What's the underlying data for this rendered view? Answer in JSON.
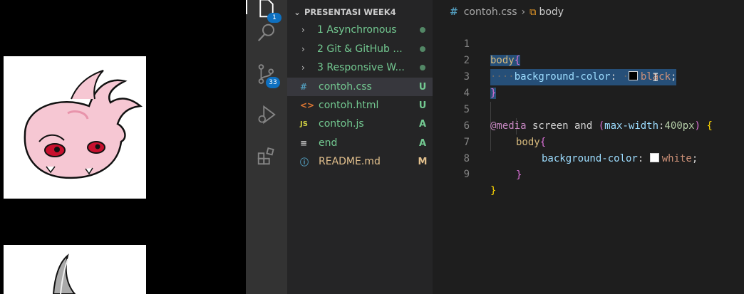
{
  "explorer": {
    "section_title": "PRESENTASI WEEK4",
    "items": [
      {
        "name": "1 Asynchronous",
        "type": "folder",
        "status": "dot",
        "color": "#73c991"
      },
      {
        "name": "2 Git & GitHub ...",
        "type": "folder",
        "status": "dot",
        "color": "#73c991"
      },
      {
        "name": "3 Responsive W...",
        "type": "folder",
        "status": "dot",
        "color": "#73c991"
      },
      {
        "name": "contoh.css",
        "type": "css",
        "icon": "#",
        "status": "U",
        "color": "#73c991"
      },
      {
        "name": "contoh.html",
        "type": "html",
        "icon": "<>",
        "status": "U",
        "color": "#73c991"
      },
      {
        "name": "contoh.js",
        "type": "js",
        "icon": "JS",
        "status": "A",
        "color": "#73c991"
      },
      {
        "name": "end",
        "type": "file",
        "icon": "≡",
        "status": "A",
        "color": "#73c991"
      },
      {
        "name": "README.md",
        "type": "md",
        "icon": "ⓘ",
        "status": "M",
        "color": "#e2c08d"
      }
    ]
  },
  "activity_bar": {
    "scm_badge": "33",
    "explorer_badge": "1"
  },
  "breadcrumb": {
    "file": "contoh.css",
    "symbol": "body"
  },
  "editor": {
    "line_numbers": [
      "1",
      "2",
      "3",
      "4",
      "5",
      "6",
      "7",
      "8",
      "9"
    ],
    "l1_selector": "body",
    "l1_brace": "{",
    "l2_prop": "background-color",
    "l2_colon": ": ",
    "l2_value": "black",
    "l2_semi": ";",
    "l3_brace": "}",
    "l5_at": "@media",
    "l5_screen": " screen and ",
    "l5_paren_open": "(",
    "l5_feature": "max-width",
    "l5_colon": ":",
    "l5_num": "400px",
    "l5_paren_close": ")",
    "l5_brace": " {",
    "l6_selector": "body",
    "l6_brace": "{",
    "l7_prop": "background-color",
    "l7_colon": ": ",
    "l7_value": "white",
    "l7_semi": ";",
    "l8_brace": "}",
    "l9_brace": "}"
  }
}
